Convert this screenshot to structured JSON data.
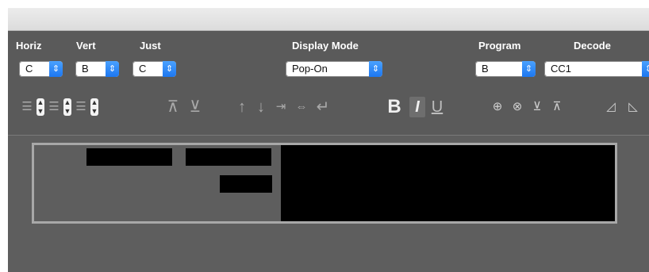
{
  "window": {
    "title": ""
  },
  "labels": {
    "horiz": "Horiz",
    "vert": "Vert",
    "just": "Just",
    "display_mode": "Display Mode",
    "program": "Program",
    "decode": "Decode"
  },
  "popups": {
    "horiz": "C",
    "vert": "B",
    "just": "C",
    "display_mode": "Pop-On",
    "program": "B",
    "decode": "CC1"
  },
  "toolbar": {
    "bold": "B",
    "italic": "I",
    "underline": "U"
  },
  "icons": [
    "align-left-icon",
    "align-center-icon",
    "align-right-icon",
    "top-align-icon",
    "bottom-align-icon",
    "arrow-up-icon",
    "arrow-down-icon",
    "indent-left-icon",
    "indent-center-icon",
    "return-icon",
    "bold-icon",
    "italic-icon",
    "underline-icon",
    "add-circle-icon",
    "remove-circle-icon",
    "move-down-icon",
    "move-up-icon",
    "triangle-left-icon",
    "triangle-right-icon"
  ],
  "colors": {
    "panel": "#5a5a5a",
    "accent": "#1c77f0",
    "caption": "#000000"
  }
}
